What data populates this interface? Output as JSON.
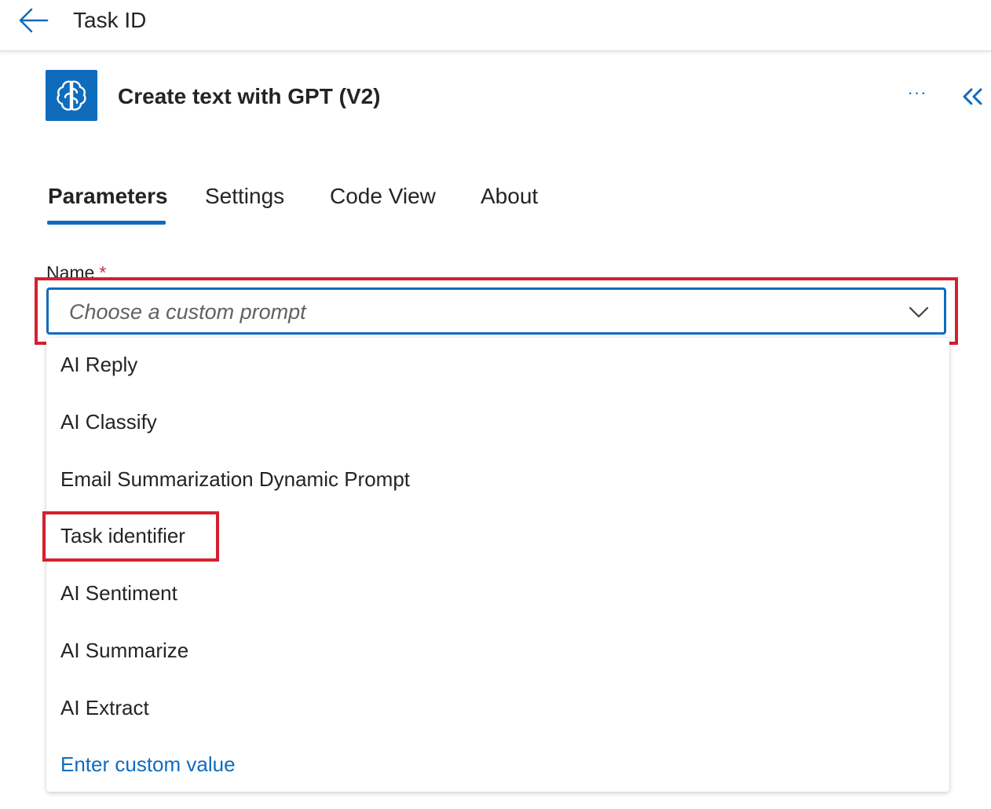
{
  "topbar": {
    "back_icon": "arrow-left-icon",
    "title": "Task ID"
  },
  "action": {
    "icon": "ai-brain-icon",
    "title": "Create text with GPT (V2)",
    "more_label": "···",
    "collapse_icon": "double-chevron-left-icon"
  },
  "tabs": [
    {
      "label": "Parameters",
      "active": true
    },
    {
      "label": "Settings",
      "active": false
    },
    {
      "label": "Code View",
      "active": false
    },
    {
      "label": "About",
      "active": false
    }
  ],
  "field": {
    "label": "Name",
    "required_mark": "*",
    "placeholder": "Choose a custom prompt",
    "chevron_icon": "chevron-down-icon"
  },
  "dropdown": {
    "options": [
      "AI Reply",
      "AI Classify",
      "Email Summarization Dynamic Prompt",
      "Task identifier",
      "AI Sentiment",
      "AI Summarize",
      "AI Extract"
    ],
    "custom_value_label": "Enter custom value"
  },
  "colors": {
    "accent": "#0f6cbd",
    "highlight": "#d4202e",
    "required": "#c4314b"
  }
}
